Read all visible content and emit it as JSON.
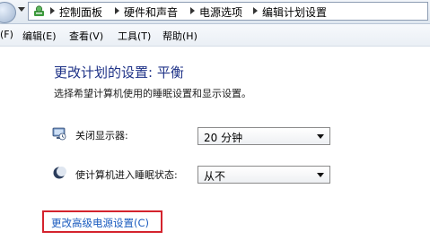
{
  "breadcrumb": [
    "控制面板",
    "硬件和声音",
    "电源选项",
    "编辑计划设置"
  ],
  "menu": [
    "(F)",
    "编辑(E)",
    "查看(V)",
    "工具(T)",
    "帮助(H)"
  ],
  "page": {
    "title": "更改计划的设置: 平衡",
    "subtitle": "选择希望计算机使用的睡眠设置和显示设置。"
  },
  "settings": [
    {
      "label": "关闭显示器:",
      "value": "20 分钟",
      "icon": "monitor-icon"
    },
    {
      "label": "使计算机进入睡眠状态:",
      "value": "从不",
      "icon": "moon-icon"
    }
  ],
  "advanced_link": "更改高级电源设置(C)",
  "colors": {
    "title": "#1e3287",
    "link": "#1a5bbf",
    "highlight": "#d4232d"
  }
}
